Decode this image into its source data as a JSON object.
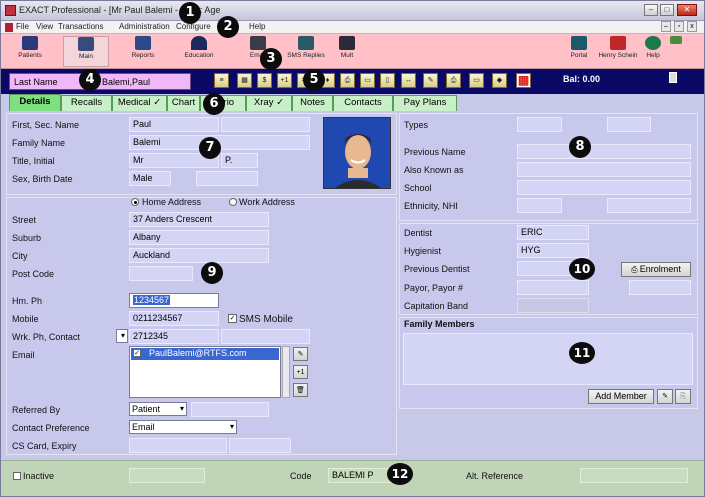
{
  "window": {
    "title": "EXACT Professional - [Mr Paul Balemi - DOB: Age"
  },
  "menu": {
    "items": [
      "File",
      "View",
      "Transactions",
      "Administration",
      "Configure",
      "Help"
    ]
  },
  "toolbar": {
    "items": [
      "Patients",
      "Main",
      "Reports",
      "Education",
      "Email",
      "SMS Replies",
      "Mult",
      "Portal",
      "Henry Schein",
      "Help"
    ]
  },
  "patient_bar": {
    "field_label": "Last Name",
    "field_value": "Balemi,Paul",
    "balance": "Bal: 0.00",
    "small_buttons": [
      "≡",
      "▦",
      "$",
      "+1",
      "✂",
      "♦",
      "⎙",
      "▭",
      "▯",
      "↔",
      "✎",
      "⎙",
      "▭",
      "◆",
      "▦",
      "✚"
    ]
  },
  "tabs": [
    "Details",
    "Recalls",
    "Medical ✓",
    "Chart",
    "Perio",
    "Xray ✓",
    "Notes",
    "Contacts",
    "Pay Plans"
  ],
  "personal": {
    "first_label": "First, Sec. Name",
    "first": "Paul",
    "family_label": "Family Name",
    "family": "Balemi",
    "title_label": "Title, Initial",
    "title": "Mr",
    "initial": "P.",
    "sex_label": "Sex, Birth Date",
    "sex": "Male"
  },
  "address": {
    "home_label": "Home Address",
    "work_label": "Work Address",
    "street_label": "Street",
    "street": "37 Anders Crescent",
    "suburb_label": "Suburb",
    "suburb": "Albany",
    "city_label": "City",
    "city": "Auckland",
    "postcode_label": "Post Code"
  },
  "contact": {
    "hm_label": "Hm. Ph",
    "hm": "1234567",
    "mobile_label": "Mobile",
    "mobile": "0211234567",
    "sms_label": "SMS Mobile",
    "wrk_label": "Wrk. Ph, Contact",
    "wrk": "2712345",
    "email_label": "Email",
    "email": "PaulBalemi@RTFS.com",
    "referred_label": "Referred By",
    "referred": "Patient",
    "pref_label": "Contact Preference",
    "pref": "Email",
    "cs_label": "CS Card, Expiry"
  },
  "identity": {
    "types_label": "Types",
    "prev_label": "Previous Name",
    "aka_label": "Also Known as",
    "school_label": "School",
    "eth_label": "Ethnicity, NHI"
  },
  "dental": {
    "dentist_label": "Dentist",
    "dentist": "ERIC",
    "hyg_label": "Hygienist",
    "hyg": "HYG",
    "prevdent_label": "Previous Dentist",
    "enrol": "Enrolment",
    "payor_label": "Payor, Payor #",
    "cap_label": "Capitation Band"
  },
  "family": {
    "title": "Family Members",
    "add": "Add Member"
  },
  "status": {
    "inactive": "Inactive",
    "code_label": "Code",
    "code": "BALEMI P",
    "alt_label": "Alt. Reference"
  },
  "callouts": [
    "1",
    "2",
    "3",
    "4",
    "5",
    "6",
    "7",
    "8",
    "9",
    "10",
    "11",
    "12"
  ]
}
